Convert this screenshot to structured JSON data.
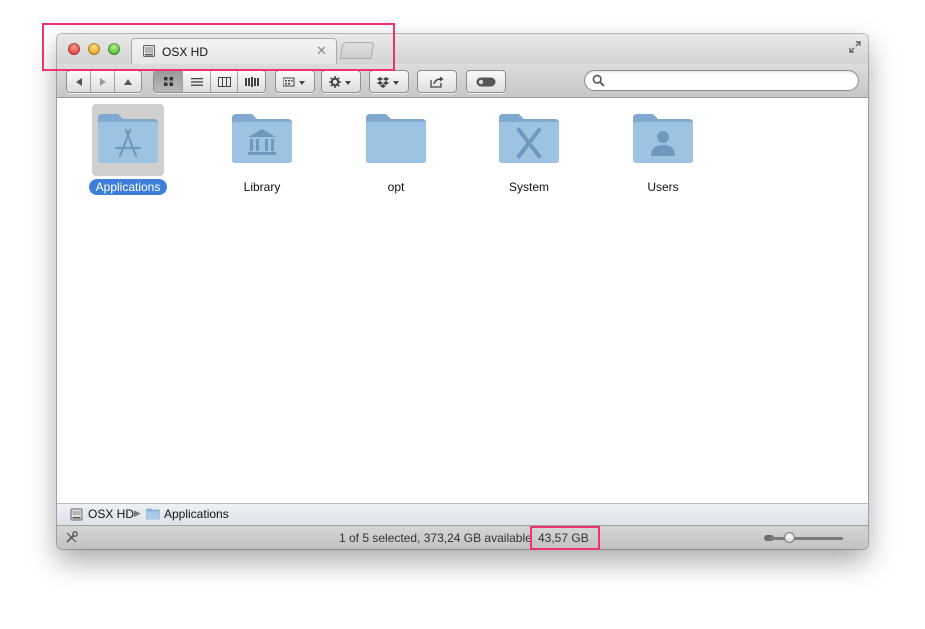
{
  "window": {
    "tab": {
      "title": "OSX HD",
      "close_glyph": "✕"
    },
    "icons": [
      "close-button",
      "minimize-button",
      "zoom-button",
      "drive-icon",
      "fullscreen-icon"
    ]
  },
  "toolbar": {
    "view_mode_selected": "icon",
    "search": {
      "placeholder": "",
      "value": ""
    }
  },
  "items": [
    {
      "label": "Applications",
      "icon": "applications-folder",
      "selected": true
    },
    {
      "label": "Library",
      "icon": "library-folder",
      "selected": false
    },
    {
      "label": "opt",
      "icon": "plain-folder",
      "selected": false
    },
    {
      "label": "System",
      "icon": "system-folder",
      "selected": false
    },
    {
      "label": "Users",
      "icon": "users-folder",
      "selected": false
    }
  ],
  "pathbar": {
    "items": [
      {
        "label": "OSX HD",
        "icon": "drive-icon"
      },
      {
        "label": "Applications",
        "icon": "folder-icon"
      }
    ]
  },
  "statusbar": {
    "text": "1 of 5 selected, 373,24 GB available",
    "size": "43,57 GB",
    "zoom_slider_fraction": 0.28
  },
  "colors": {
    "highlight": "#f0326e",
    "selection": "#3d7fd8",
    "folder": "#8fb7da"
  }
}
